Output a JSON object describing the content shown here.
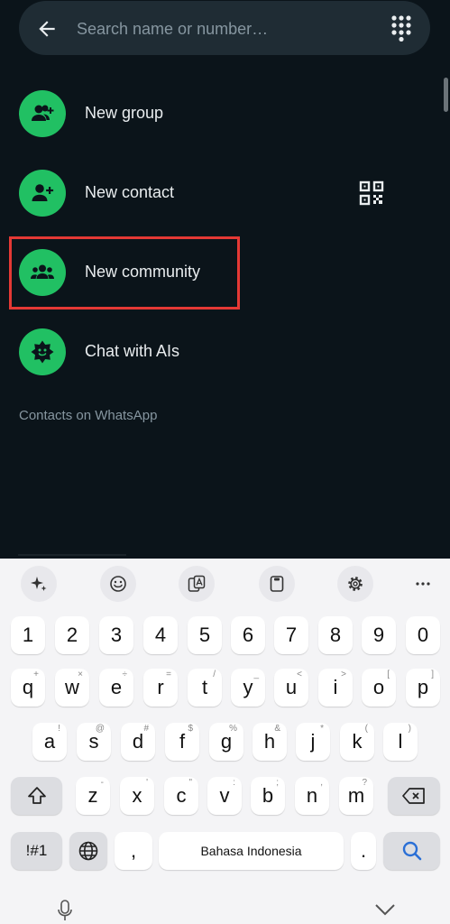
{
  "search": {
    "placeholder": "Search name or number…"
  },
  "actions": [
    {
      "label": "New group",
      "icon": "group-add-icon"
    },
    {
      "label": "New contact",
      "icon": "person-add-icon"
    },
    {
      "label": "New community",
      "icon": "community-icon"
    },
    {
      "label": "Chat with AIs",
      "icon": "ai-chat-icon"
    }
  ],
  "section_label": "Contacts on WhatsApp",
  "colors": {
    "accent": "#21c063",
    "background": "#0b141a",
    "highlight": "#e53935"
  },
  "keyboard": {
    "toolbar": [
      "sparkle-icon",
      "emoji-icon",
      "translate-icon",
      "clipboard-icon",
      "settings-icon",
      "more-icon"
    ],
    "numbers": [
      "1",
      "2",
      "3",
      "4",
      "5",
      "6",
      "7",
      "8",
      "9",
      "0"
    ],
    "row1": {
      "keys": [
        "q",
        "w",
        "e",
        "r",
        "t",
        "y",
        "u",
        "i",
        "o",
        "p"
      ],
      "subs": [
        "+",
        "×",
        "÷",
        "=",
        "/",
        "_",
        "<",
        ">",
        "[",
        "]"
      ]
    },
    "row2": {
      "keys": [
        "a",
        "s",
        "d",
        "f",
        "g",
        "h",
        "j",
        "k",
        "l"
      ],
      "subs": [
        "!",
        "@",
        "#",
        "$",
        "%",
        "&",
        "*",
        "(",
        ")"
      ]
    },
    "row3": {
      "keys": [
        "z",
        "x",
        "c",
        "v",
        "b",
        "n",
        "m"
      ],
      "subs": [
        "-",
        "'",
        "\"",
        ":",
        ";",
        ",",
        "?"
      ]
    },
    "symbols_label": "!#1",
    "comma": ",",
    "space_label": "Bahasa Indonesia",
    "period": "."
  }
}
